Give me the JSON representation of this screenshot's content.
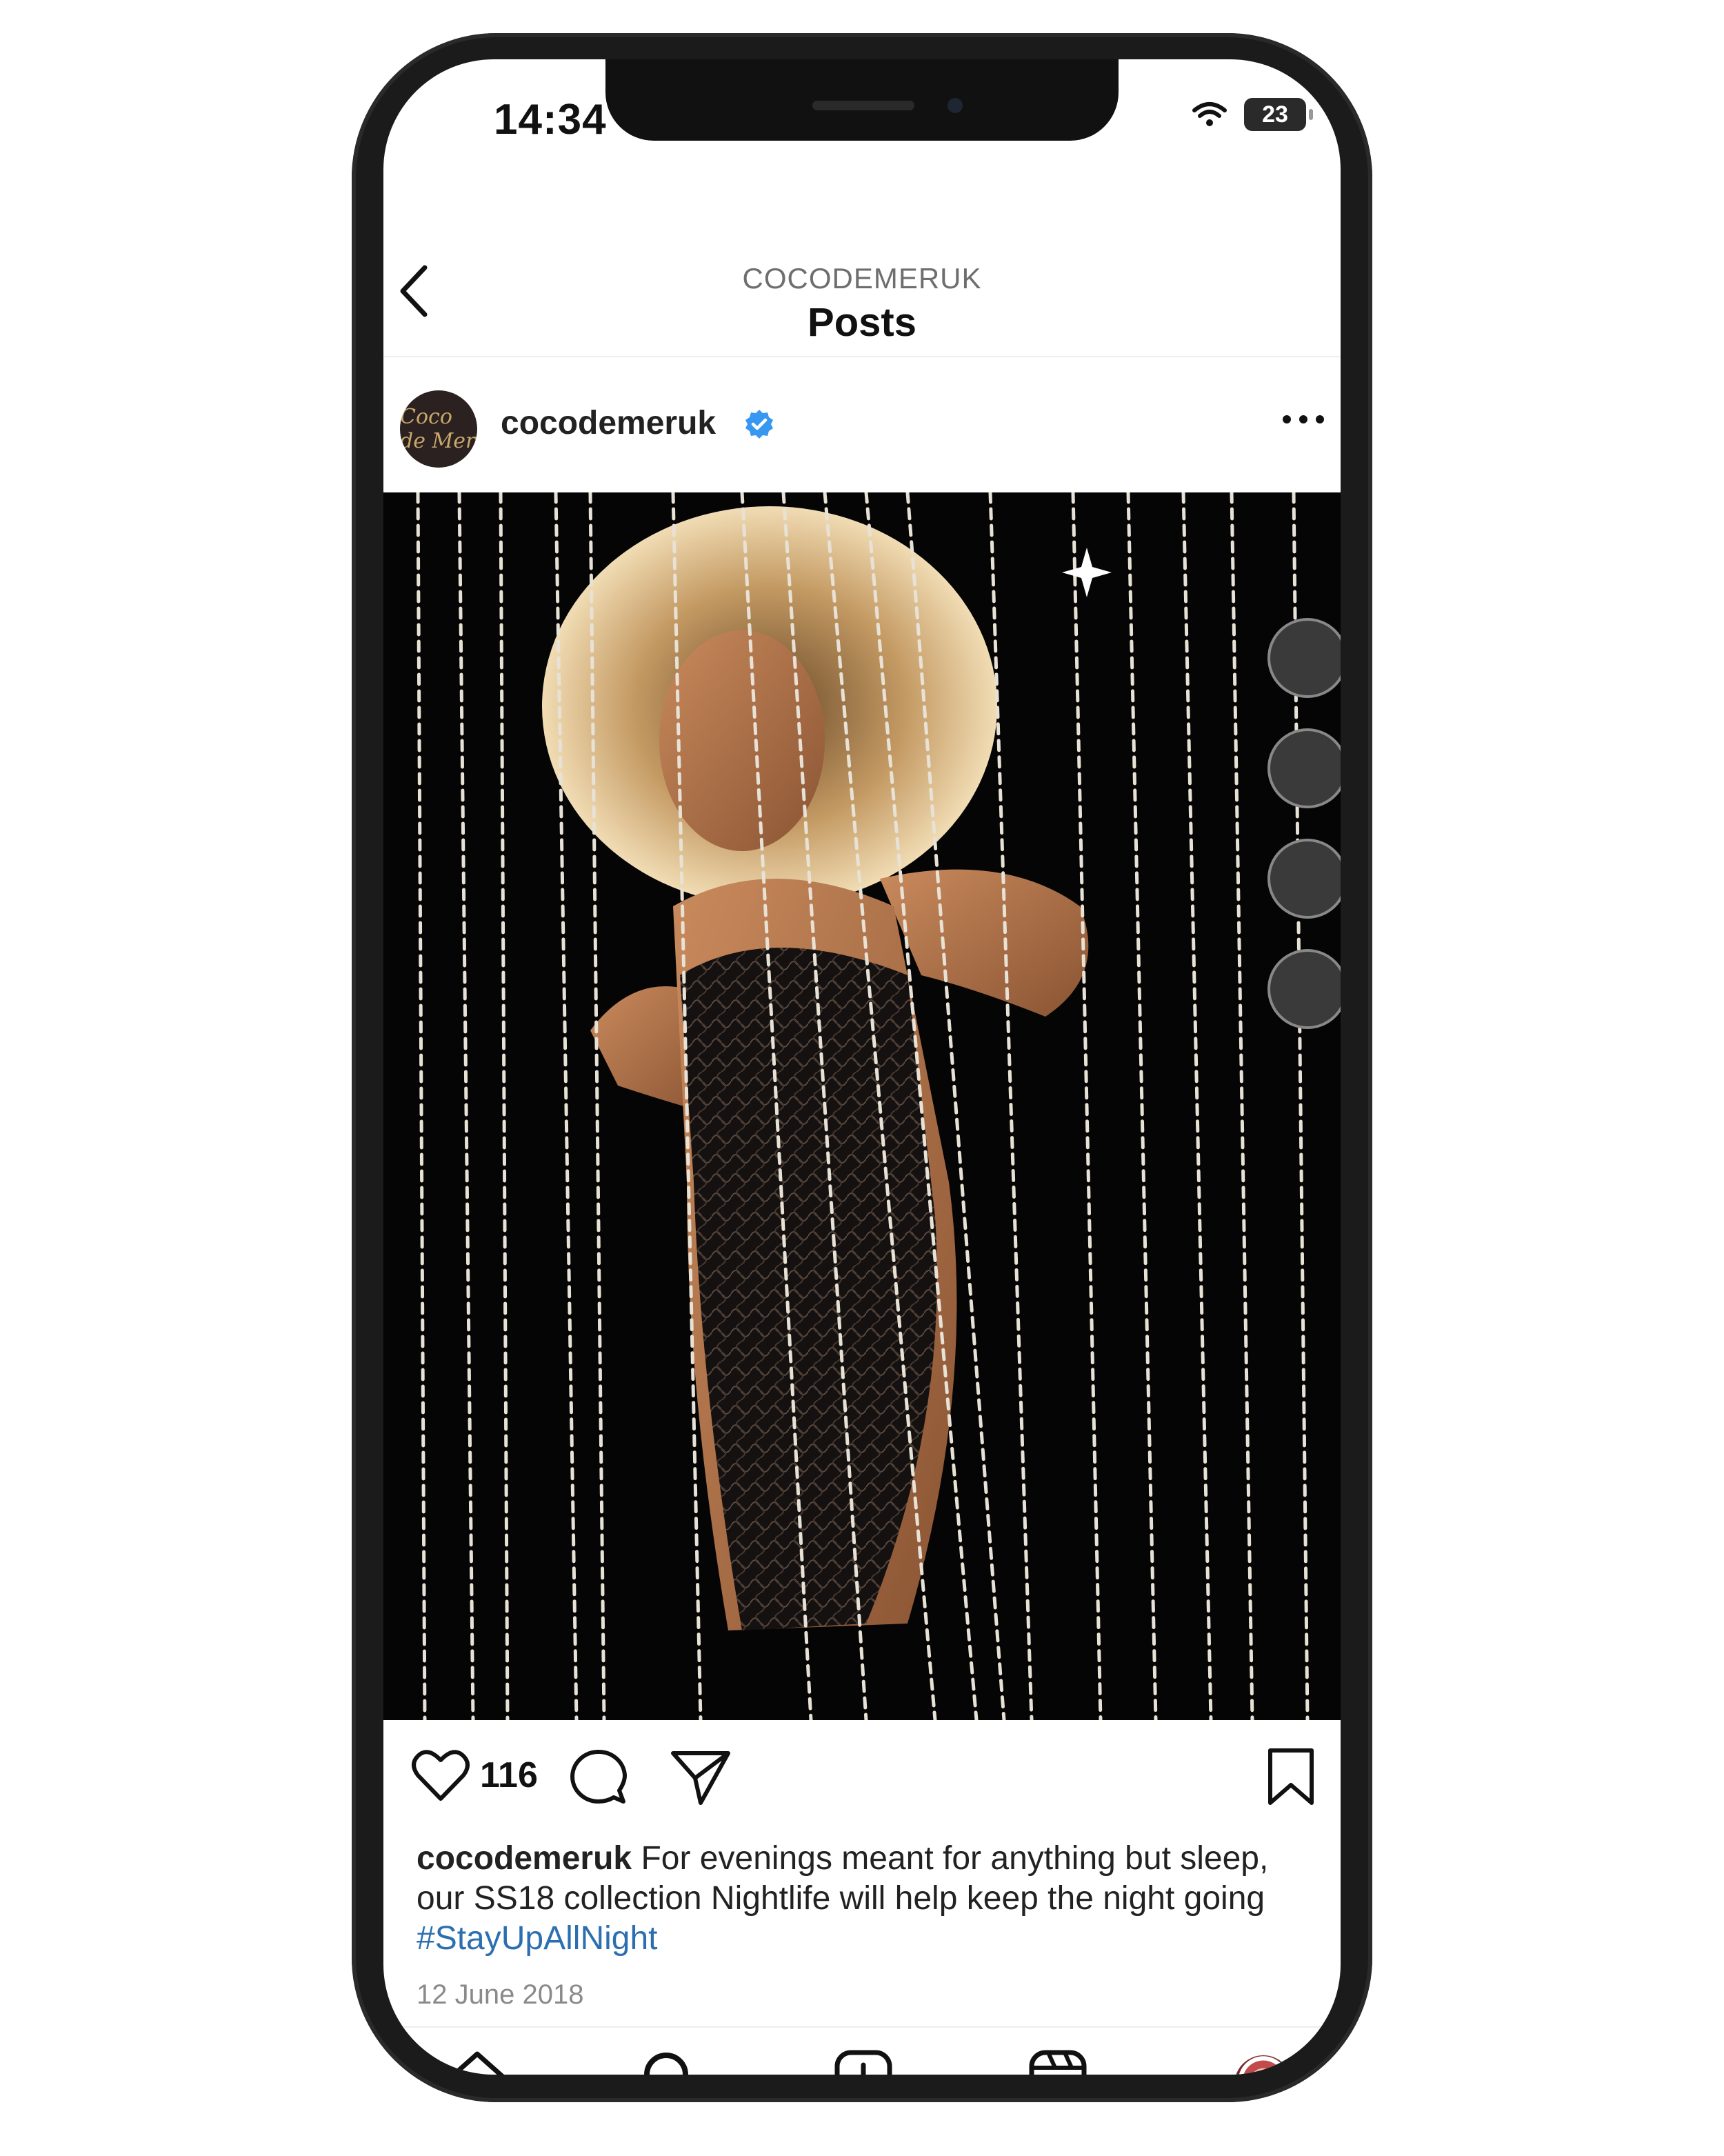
{
  "status_bar": {
    "time": "14:34",
    "battery": "23"
  },
  "header": {
    "account": "COCODEMERUK",
    "title": "Posts"
  },
  "post": {
    "avatar_text": "Coco de Mer",
    "username": "cocodemeruk",
    "likes": "116",
    "caption_user": "cocodemeruk",
    "caption_text": " For evenings meant for anything but sleep, our SS18 collection Nightlife will help keep the night going ",
    "hashtag": "#StayUpAllNight",
    "date": "12 June 2018"
  },
  "colors": {
    "hashtag": "#2c6fb0",
    "verified": "#3897f0"
  },
  "icons": {
    "actions": [
      "heart-icon",
      "comment-icon",
      "share-icon",
      "bookmark-icon"
    ],
    "tabs": [
      "home-icon",
      "search-icon",
      "new-post-icon",
      "reels-icon",
      "profile-avatar"
    ]
  }
}
